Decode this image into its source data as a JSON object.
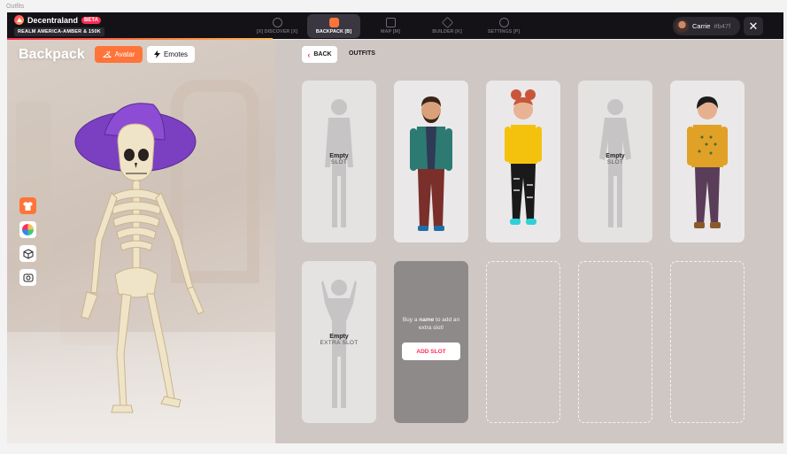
{
  "window": {
    "title": "Outfits"
  },
  "topbar": {
    "brand": "Decentraland",
    "beta": "BETA",
    "realm": "REALM AMERICA-AMBER & 150K",
    "nav": [
      {
        "label": "[X] DISCOVER [X]",
        "icon": "compass-icon"
      },
      {
        "label": "BACKPACK [B]",
        "icon": "backpack-icon",
        "active": true
      },
      {
        "label": "MAP [M]",
        "icon": "map-icon"
      },
      {
        "label": "BUILDER [K]",
        "icon": "cube-icon"
      },
      {
        "label": "SETTINGS [P]",
        "icon": "gear-icon"
      }
    ],
    "user": {
      "name": "Carrie",
      "tag": "#b47f"
    },
    "close": "✕"
  },
  "left": {
    "title": "Backpack",
    "tabs": {
      "avatar": "Avatar",
      "emotes": "Emotes"
    },
    "tools": [
      "shirt-icon",
      "color-wheel-icon",
      "nft-cube-icon",
      "screenshot-icon"
    ]
  },
  "right": {
    "back": "BACK",
    "crumb": "OUTFITS",
    "slots": [
      {
        "type": "empty",
        "l1": "Empty",
        "l2": "SLOT"
      },
      {
        "type": "outfit",
        "name": "bearded-man-outfit"
      },
      {
        "type": "outfit",
        "name": "yellow-top-outfit"
      },
      {
        "type": "empty",
        "l1": "Empty",
        "l2": "SLOT"
      },
      {
        "type": "outfit",
        "name": "mustard-sweater-outfit"
      },
      {
        "type": "empty",
        "l1": "Empty",
        "l2": "EXTRA SLOT"
      },
      {
        "type": "buy",
        "text_pre": "Buy a ",
        "text_bold": "name",
        "text_post": " to add an extra slot!",
        "button": "ADD SLOT"
      },
      {
        "type": "locked"
      },
      {
        "type": "locked"
      },
      {
        "type": "locked"
      }
    ]
  },
  "colors": {
    "accent": "#ff7439",
    "brand_pink": "#ff2d55",
    "topbar": "#141216"
  }
}
